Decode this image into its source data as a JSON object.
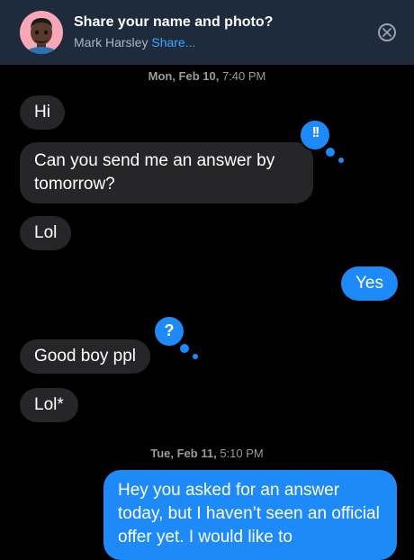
{
  "banner": {
    "title": "Share your name and photo?",
    "name": "Mark Harsley",
    "share_label": "Share..."
  },
  "timestamps": [
    {
      "day": "Mon, Feb 10,",
      "time": "7:40 PM"
    },
    {
      "day": "Tue, Feb 11,",
      "time": "5:10 PM"
    }
  ],
  "messages": [
    {
      "text": "Hi",
      "direction": "incoming"
    },
    {
      "text": "Can you send me an answer by tomorrow?",
      "direction": "incoming",
      "tapback": "!!"
    },
    {
      "text": "Lol",
      "direction": "incoming"
    },
    {
      "text": "Yes",
      "direction": "outgoing"
    },
    {
      "text": "Good boy ppl",
      "direction": "incoming",
      "tapback": "?"
    },
    {
      "text": "Lol*",
      "direction": "incoming"
    },
    {
      "text": "Hey you asked for an answer today, but I haven’t seen an official offer yet. I would like to",
      "direction": "outgoing"
    }
  ],
  "icons": {
    "close": "close-circle-icon",
    "avatar": "memoji-avatar"
  },
  "colors": {
    "incoming_bubble": "#262628",
    "outgoing_bubble": "#1d8af7",
    "background": "#000000",
    "banner": "#1d2b3c",
    "link": "#3ea6ff"
  }
}
